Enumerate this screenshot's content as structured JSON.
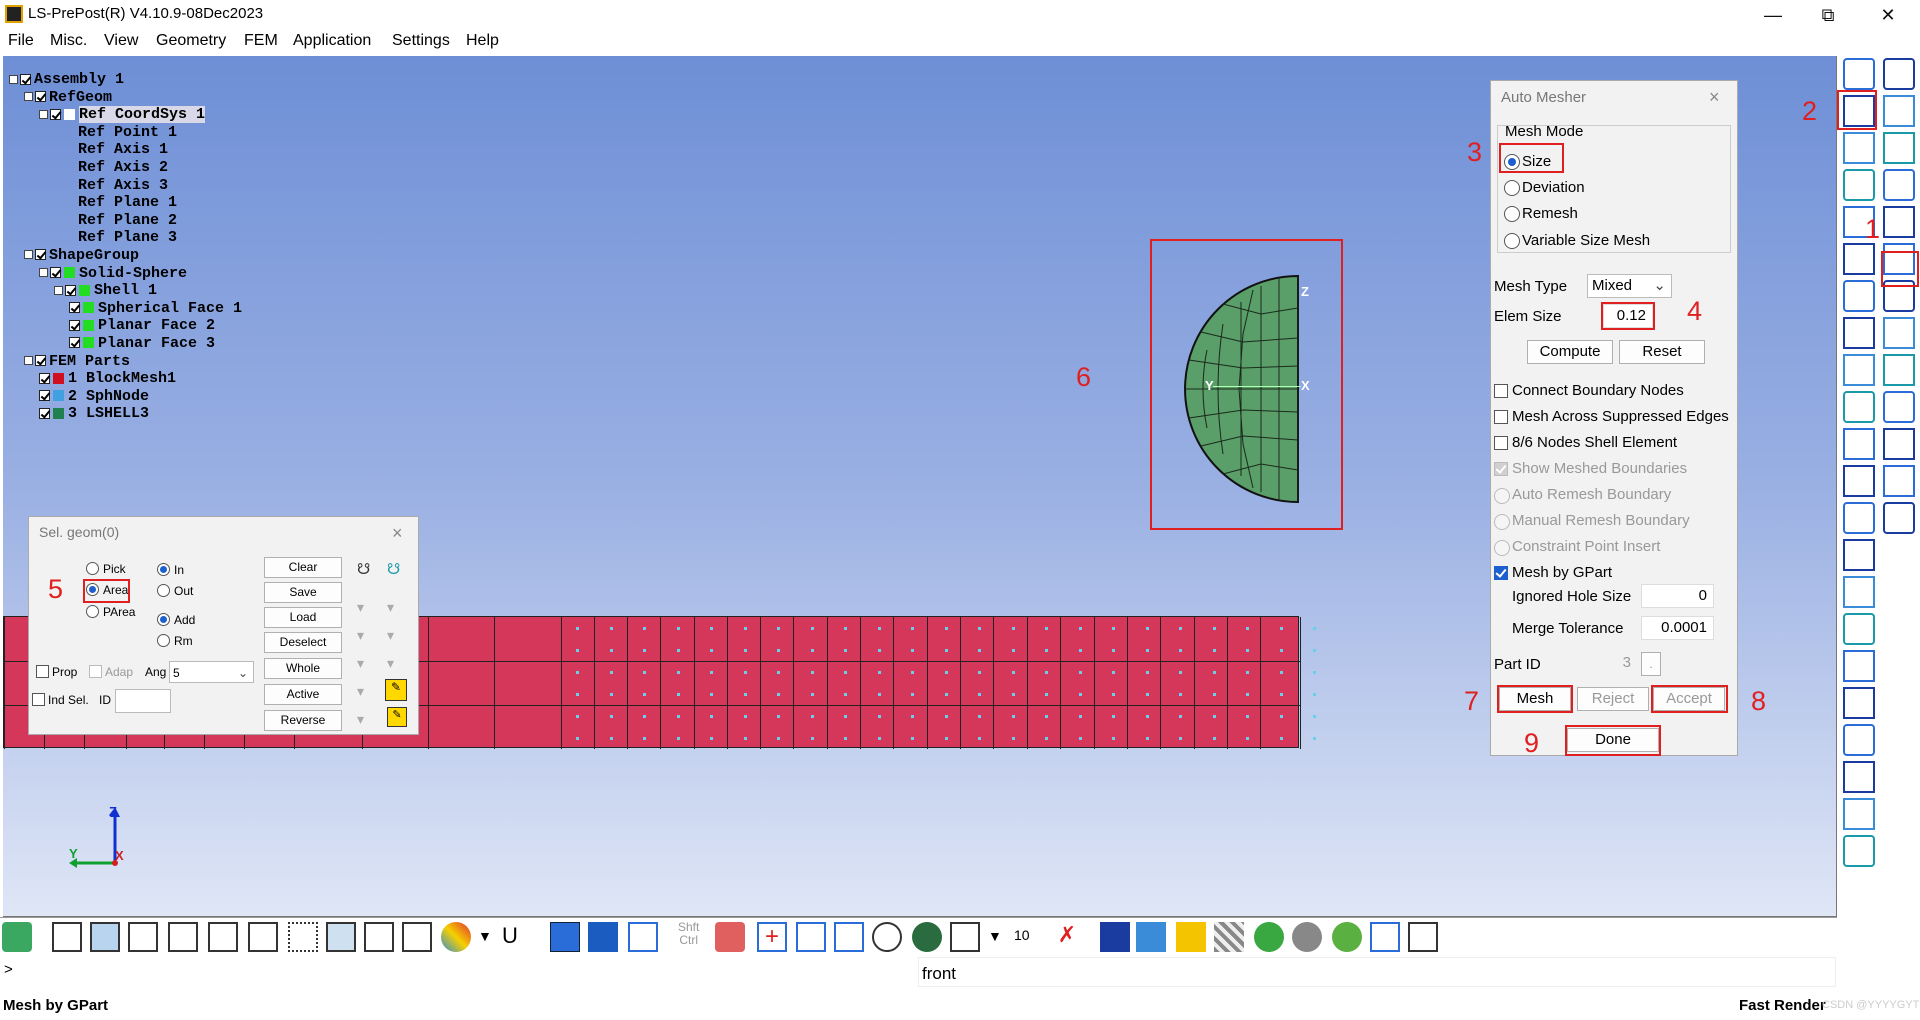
{
  "window": {
    "title": "LS-PrePost(R) V4.10.9-08Dec2023"
  },
  "menu": [
    "File",
    "Misc.",
    "View",
    "Geometry",
    "FEM",
    "Application",
    "Settings",
    "Help"
  ],
  "tree": [
    {
      "label": "Assembly 1",
      "level": 0,
      "expander": true,
      "checkbox": true
    },
    {
      "label": "RefGeom",
      "level": 1,
      "expander": true,
      "checkbox": true
    },
    {
      "label": "Ref CoordSys 1",
      "level": 2,
      "expander": true,
      "checkbox": true,
      "swatch": "#ffffff",
      "selected": true
    },
    {
      "label": "Ref Point 1",
      "level": 3
    },
    {
      "label": "Ref Axis 1",
      "level": 3
    },
    {
      "label": "Ref Axis 2",
      "level": 3
    },
    {
      "label": "Ref Axis 3",
      "level": 3
    },
    {
      "label": "Ref Plane 1",
      "level": 3
    },
    {
      "label": "Ref Plane 2",
      "level": 3
    },
    {
      "label": "Ref Plane 3",
      "level": 3
    },
    {
      "label": "ShapeGroup",
      "level": 1,
      "expander": true,
      "checkbox": true
    },
    {
      "label": "Solid-Sphere",
      "level": 2,
      "expander": true,
      "checkbox": true,
      "swatch": "#22dd22"
    },
    {
      "label": "Shell 1",
      "level": 3,
      "expander": true,
      "checkbox": true,
      "swatch": "#22dd22"
    },
    {
      "label": "Spherical Face 1",
      "level": 4,
      "checkbox": true,
      "swatch": "#22dd22"
    },
    {
      "label": "Planar Face 2",
      "level": 4,
      "checkbox": true,
      "swatch": "#22dd22"
    },
    {
      "label": "Planar Face 3",
      "level": 4,
      "checkbox": true,
      "swatch": "#22dd22"
    },
    {
      "label": "FEM Parts",
      "level": 1,
      "expander": true,
      "checkbox": true
    },
    {
      "label": "1 BlockMesh1",
      "level": 2,
      "checkbox": true,
      "swatch": "#d01020"
    },
    {
      "label": "2 SphNode",
      "level": 2,
      "checkbox": true,
      "swatch": "#40a0e0"
    },
    {
      "label": "3 LSHELL3",
      "level": 2,
      "checkbox": true,
      "swatch": "#208050"
    }
  ],
  "shape_labels": {
    "z": "Z",
    "x": "X",
    "y": "Y"
  },
  "axis_triad": {
    "z": "Z",
    "y": "Y",
    "x": "X"
  },
  "sel_geom": {
    "title": "Sel. geom(0)",
    "close": "×",
    "pick": "Pick",
    "area": "Area",
    "parea": "PArea",
    "in": "In",
    "out": "Out",
    "add": "Add",
    "rm": "Rm",
    "prop": "Prop",
    "adap": "Adap",
    "ang": "Ang",
    "ang_value": "5",
    "ind_sel": "Ind Sel.",
    "id": "ID",
    "buttons": [
      "Clear",
      "Save",
      "Load",
      "Deselect",
      "Whole",
      "Active",
      "Reverse"
    ]
  },
  "auto_mesher": {
    "title": "Auto Mesher",
    "close": "×",
    "mesh_mode": "Mesh Mode",
    "modes": [
      "Size",
      "Deviation",
      "Remesh",
      "Variable Size Mesh"
    ],
    "mesh_type_label": "Mesh Type",
    "mesh_type_value": "Mixed",
    "elem_size_label": "Elem Size",
    "elem_size_value": "0.12",
    "compute": "Compute",
    "reset": "Reset",
    "options": [
      {
        "label": "Connect Boundary Nodes",
        "state": "off"
      },
      {
        "label": "Mesh Across Suppressed Edges",
        "state": "off"
      },
      {
        "label": "8/6 Nodes Shell Element",
        "state": "off"
      },
      {
        "label": "Show Meshed Boundaries",
        "state": "disabled-on"
      },
      {
        "label": "Auto Remesh Boundary",
        "state": "disabled-radio"
      },
      {
        "label": "Manual Remesh Boundary",
        "state": "disabled-radio"
      },
      {
        "label": "Constraint Point Insert",
        "state": "disabled-radio"
      },
      {
        "label": "Mesh by GPart",
        "state": "on"
      }
    ],
    "ignored_hole_label": "Ignored Hole Size",
    "ignored_hole_value": "0",
    "merge_tol_label": "Merge Tolerance",
    "merge_tol_value": "0.0001",
    "part_id_label": "Part ID",
    "part_id_value": "3",
    "part_id_btn": ".",
    "mesh": "Mesh",
    "reject": "Reject",
    "accept": "Accept",
    "done": "Done"
  },
  "annotations": [
    "1",
    "2",
    "3",
    "4",
    "5",
    "6",
    "7",
    "8",
    "9"
  ],
  "toolbar_texts": {
    "u": "U",
    "shft": "Shft",
    "ctrl": "Ctrl",
    "num": "10"
  },
  "command": {
    "prompt": ">",
    "value": "front"
  },
  "status": {
    "left": "Mesh by GPart",
    "right": "Fast Render",
    "watermark": "CSDN @YYYYGYT"
  },
  "colors": {
    "mesh_red": "#d4375a",
    "shell_green": "#5a9e6a",
    "highlight": "#e02020",
    "accent": "#1e5fd0"
  }
}
